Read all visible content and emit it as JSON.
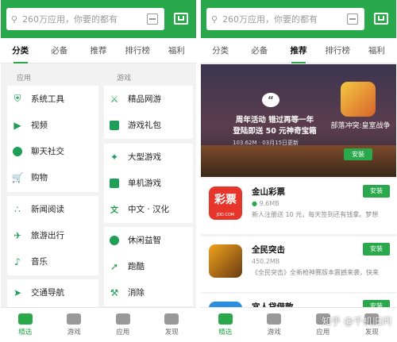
{
  "search": {
    "placeholder": "260万应用，你要的都有"
  },
  "tabs": [
    "分类",
    "必备",
    "推荐",
    "排行榜",
    "福利"
  ],
  "left": {
    "apps_header": "应用",
    "games_header": "游戏",
    "apps": [
      {
        "label": "系统工具",
        "icon": "shield-icon"
      },
      {
        "label": "视频",
        "icon": "video-icon"
      },
      {
        "label": "聊天社交",
        "icon": "chat-icon"
      },
      {
        "label": "购物",
        "icon": "cart-icon"
      },
      {
        "label": "新闻阅读",
        "icon": "rss-icon"
      },
      {
        "label": "旅游出行",
        "icon": "plane-icon"
      },
      {
        "label": "音乐",
        "icon": "music-icon"
      },
      {
        "label": "交通导航",
        "icon": "navigation-icon"
      }
    ],
    "games": [
      {
        "label": "精品网游",
        "icon": "sword-icon"
      },
      {
        "label": "游戏礼包",
        "icon": "gift-icon"
      },
      {
        "label": "大型游戏",
        "icon": "gamepad-icon"
      },
      {
        "label": "单机游戏",
        "icon": "controller-icon"
      },
      {
        "label": "中文 · 汉化",
        "icon": "text-icon"
      },
      {
        "label": "休闲益智",
        "icon": "puzzle-icon"
      },
      {
        "label": "跑酷",
        "icon": "runner-icon"
      },
      {
        "label": "消除",
        "icon": "hammer-icon"
      }
    ]
  },
  "banner": {
    "title": "周年活动 错过再等一年 登陆即送 50 元神奇宝箱",
    "meta": "103.62M · 03月15日更新",
    "game_name": "部落冲突:皇室战争",
    "install": "安装"
  },
  "apps_list": [
    {
      "name": "金山彩票",
      "size": "9.6MB",
      "desc": "新人注册送 10 元，每天签到还有钱拿。梦想",
      "install": "安装",
      "icon_text": "彩票",
      "icon_sub": "JDD.COM"
    },
    {
      "name": "全民突击",
      "size": "450.2MB",
      "desc": "《全民突击》全新枪神赛版本震撼来袭，快来",
      "install": "安装"
    },
    {
      "name": "宜人贷借款",
      "size": "",
      "desc": "",
      "install": "安装"
    }
  ],
  "bottom": [
    "精选",
    "游戏",
    "应用",
    "发现"
  ],
  "watermark": "知乎 @千机旧问",
  "colors": {
    "accent": "#29a94b",
    "icon_green": "#1f9e57"
  }
}
